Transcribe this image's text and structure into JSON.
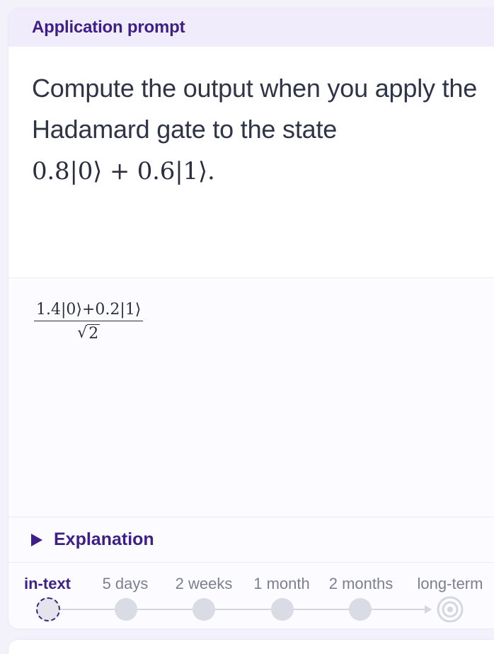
{
  "card": {
    "header_title": "Application prompt",
    "prompt_text_1": "Compute the output when you apply the Hadamard gate to the state",
    "prompt_math": "0.8|0⟩ + 0.6|1⟩.",
    "answer_numerator": "1.4|0⟩+0.2|1⟩",
    "answer_sqrt_symbol": "√",
    "answer_denominator": "2",
    "explanation_label": "Explanation"
  },
  "schedule": {
    "stages": [
      "in-text",
      "5 days",
      "2 weeks",
      "1 month",
      "2 months",
      "long-term"
    ],
    "current_stage": "in-text"
  },
  "colors": {
    "accent": "#3d1f86",
    "header_bg": "#f1ecfb",
    "dot": "#d9dce4"
  },
  "icons": {
    "explanation_toggle": "triangle-right-icon",
    "long_term_target": "target-icon"
  }
}
